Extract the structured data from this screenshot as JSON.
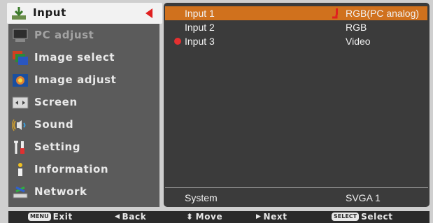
{
  "menu": {
    "items": [
      {
        "label": "Input",
        "icon": "input-icon",
        "state": "selected"
      },
      {
        "label": "PC adjust",
        "icon": "pc-adjust-icon",
        "state": "disabled"
      },
      {
        "label": "Image select",
        "icon": "image-select-icon",
        "state": "normal"
      },
      {
        "label": "Image adjust",
        "icon": "image-adjust-icon",
        "state": "normal"
      },
      {
        "label": "Screen",
        "icon": "screen-icon",
        "state": "normal"
      },
      {
        "label": "Sound",
        "icon": "sound-icon",
        "state": "normal"
      },
      {
        "label": "Setting",
        "icon": "setting-icon",
        "state": "normal"
      },
      {
        "label": "Information",
        "icon": "information-icon",
        "state": "normal"
      },
      {
        "label": "Network",
        "icon": "network-icon",
        "state": "normal"
      }
    ]
  },
  "inputs": [
    {
      "name": "Input 1",
      "value": "RGB(PC analog)",
      "highlighted": true,
      "plug_icon": true
    },
    {
      "name": "Input 2",
      "value": "RGB",
      "highlighted": false
    },
    {
      "name": "Input 3",
      "value": "Video",
      "highlighted": false,
      "active_dot": true
    }
  ],
  "system": {
    "label": "System",
    "value": "SVGA 1"
  },
  "bottom_bar": {
    "exit": {
      "key": "MENU",
      "label": "Exit"
    },
    "back": {
      "glyph": "◀",
      "label": "Back"
    },
    "move": {
      "glyph": "⬍",
      "label": "Move"
    },
    "next": {
      "glyph": "▶",
      "label": "Next"
    },
    "select": {
      "key": "SELECT",
      "label": "Select"
    }
  },
  "colors": {
    "highlight": "#d0711d",
    "accent_red": "#e02020",
    "panel": "#3b3b3b",
    "menu": "#5b5b5b"
  }
}
